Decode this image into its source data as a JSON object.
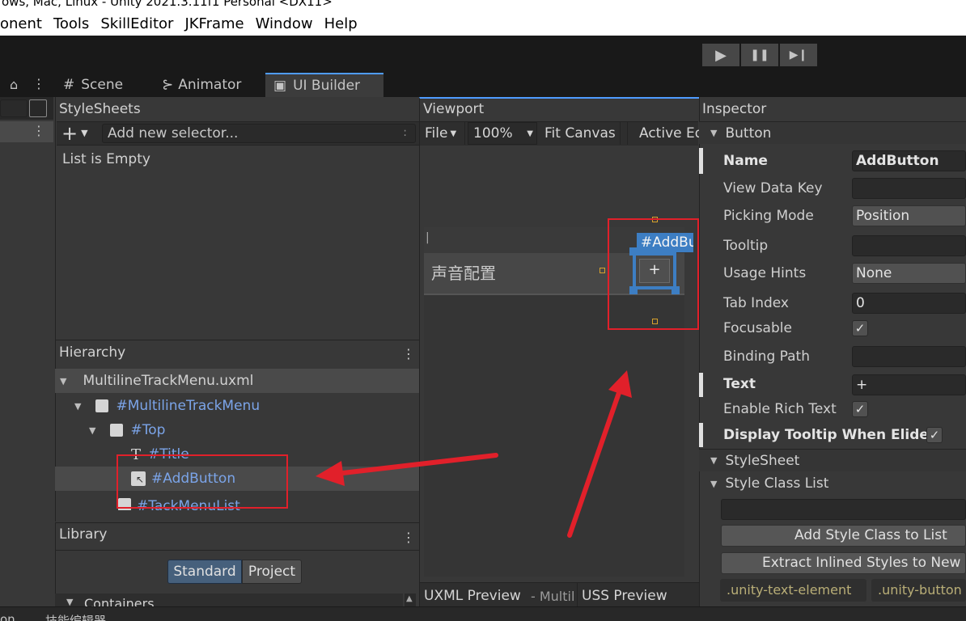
{
  "window": {
    "title": "ows, Mac, Linux - Unity 2021.3.11f1 Personal <DX11>"
  },
  "menubar": {
    "items": [
      "onent",
      "Tools",
      "SkillEditor",
      "JKFrame",
      "Window",
      "Help"
    ]
  },
  "playback": {
    "play": "▶",
    "pause": "❚❚",
    "step": "▶❙"
  },
  "tabs": [
    {
      "icon": "#",
      "label": "Scene"
    },
    {
      "icon": "⊱",
      "label": "Animator"
    },
    {
      "icon": "▣",
      "label": "UI Builder"
    }
  ],
  "stylesheets": {
    "title": "StyleSheets",
    "add_plus": "+",
    "selector_placeholder": "Add new selector...",
    "selector_colon": ":",
    "empty": "List is Empty"
  },
  "hierarchy": {
    "title": "Hierarchy",
    "root": "MultilineTrackMenu.uxml",
    "items": [
      "#MultilineTrackMenu",
      "#Top",
      "#Title",
      "#AddButton",
      "#TackMenuList"
    ]
  },
  "library": {
    "title": "Library",
    "tabs": [
      "Standard",
      "Project"
    ],
    "section": "Containers"
  },
  "viewport": {
    "title": "Viewport",
    "file": "File",
    "zoom": "100%",
    "fit_canvas": "Fit Canvas",
    "active": "Active Ed",
    "canvas_title": "声音配置",
    "button_text": "+",
    "selected_label": "#AddBu",
    "cursor_mark": "|"
  },
  "preview_bar": {
    "uxml_label": "UXML Preview",
    "uxml_file": "- Multil",
    "uss_label": "USS Preview"
  },
  "inspector": {
    "title": "Inspector",
    "button_section": "Button",
    "rows": [
      {
        "label": "Name",
        "value": "AddButton"
      },
      {
        "label": "View Data Key",
        "value": ""
      },
      {
        "label": "Picking Mode",
        "value": "Position"
      },
      {
        "label": "Tooltip",
        "value": ""
      },
      {
        "label": "Usage Hints",
        "value": "None"
      },
      {
        "label": "Tab Index",
        "value": "0"
      },
      {
        "label": "Focusable",
        "value": "✓"
      },
      {
        "label": "Binding Path",
        "value": ""
      },
      {
        "label": "Text",
        "value": "+"
      },
      {
        "label": "Enable Rich Text",
        "value": "✓"
      },
      {
        "label": "Display Tooltip When Elided",
        "value": "✓"
      }
    ],
    "stylesheet_section": "StyleSheet",
    "style_class_section": "Style Class List",
    "add_style_class": "Add Style Class to List",
    "extract_styles": "Extract Inlined Styles to New C",
    "class_tags": [
      ".unity-text-element",
      ".unity-button"
    ]
  },
  "bottom_bar": {
    "left": "on",
    "label": "技能编辑器"
  }
}
